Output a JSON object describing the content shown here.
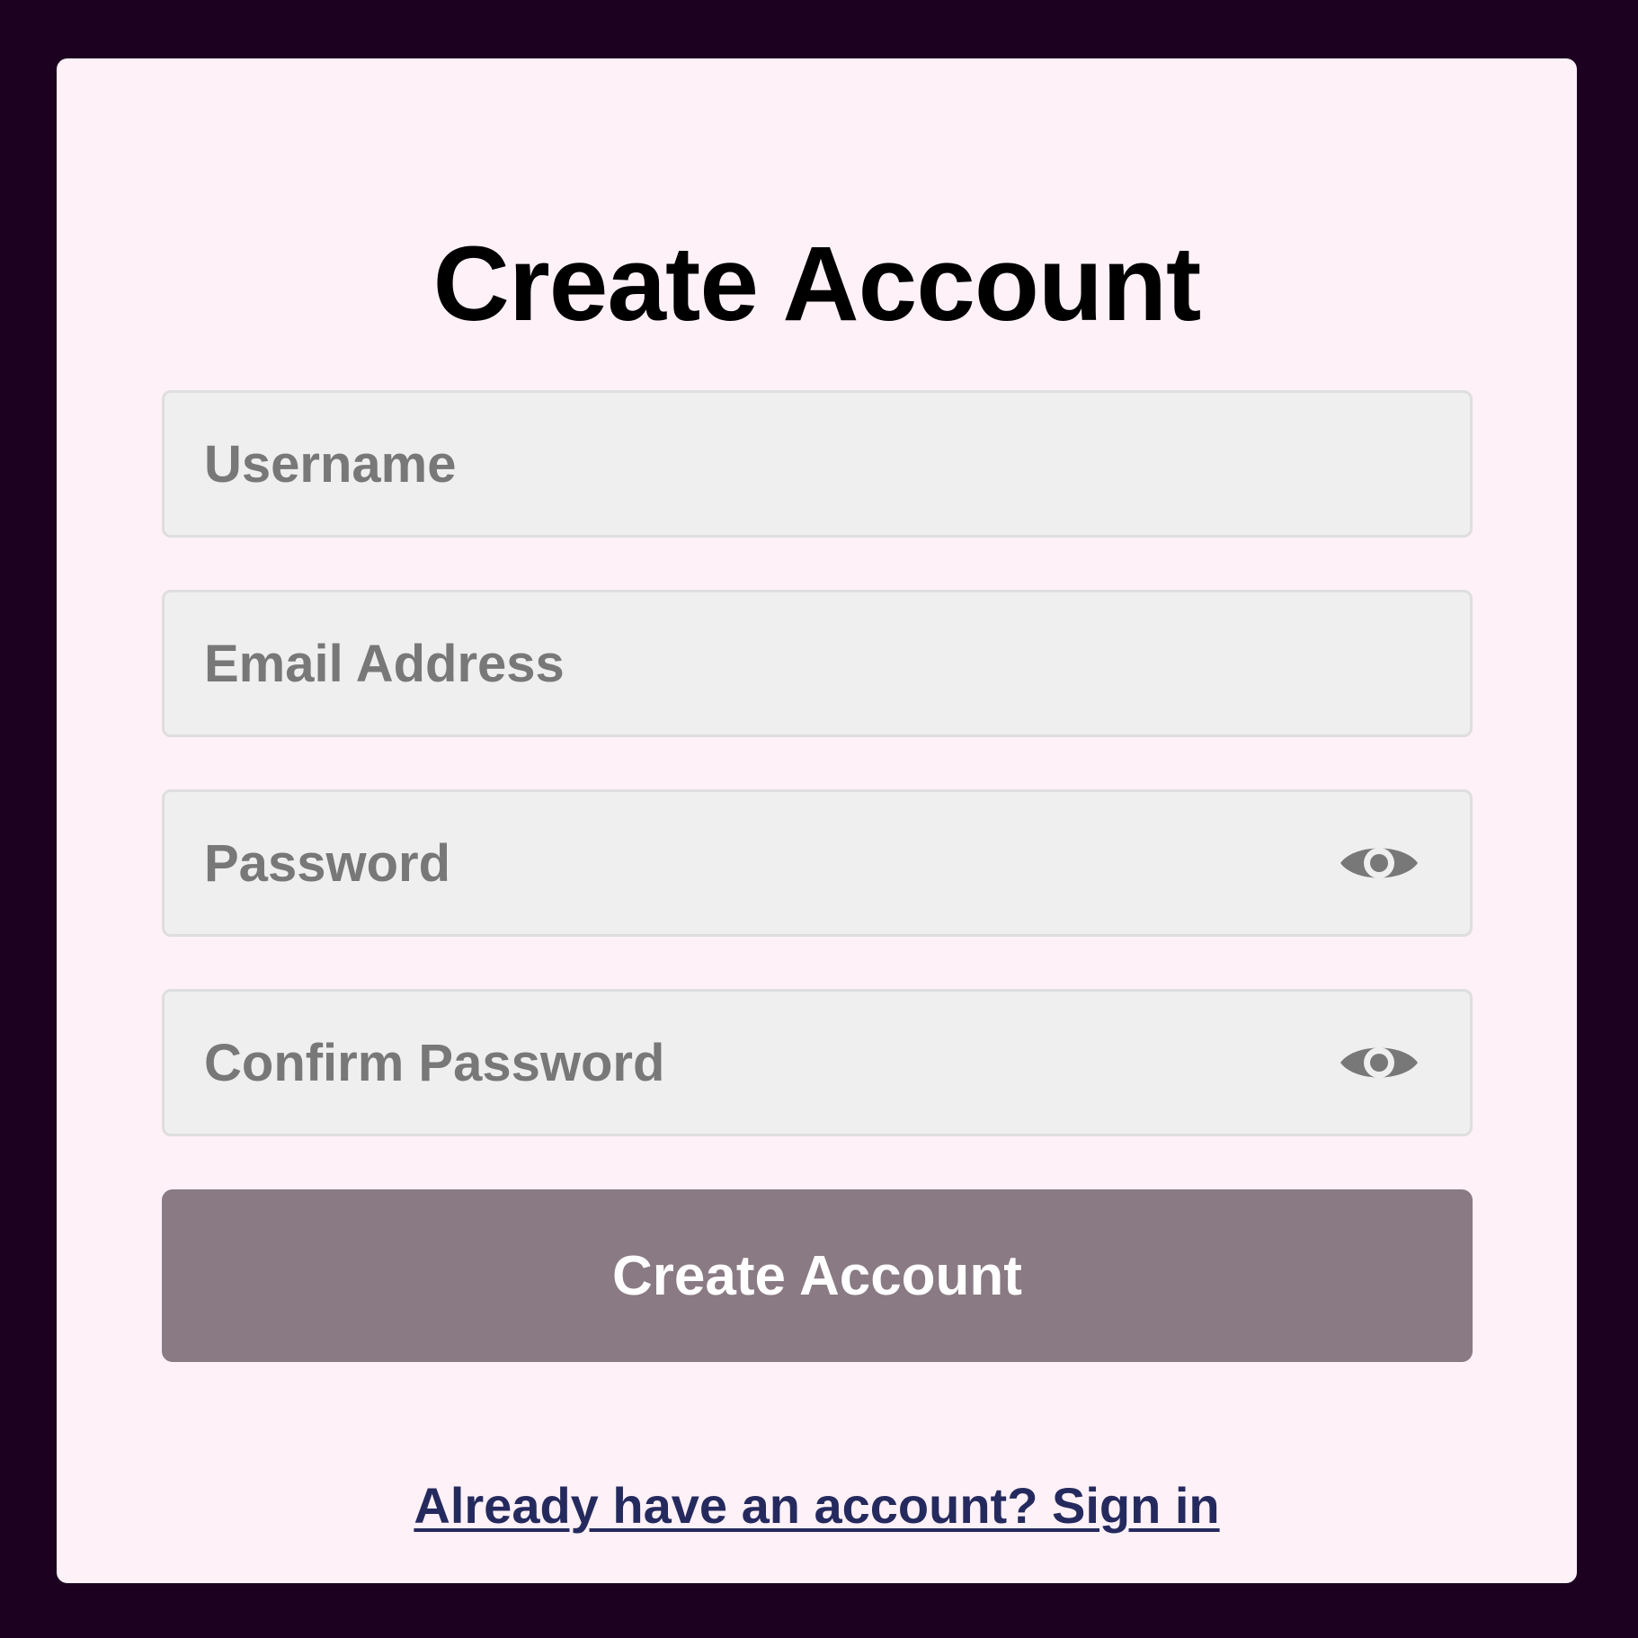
{
  "form": {
    "title": "Create Account",
    "fields": [
      {
        "name": "username",
        "placeholder": "Username",
        "value": ""
      },
      {
        "name": "email",
        "placeholder": "Email Address",
        "value": ""
      },
      {
        "name": "password",
        "placeholder": "Password",
        "value": "",
        "icon": "eye-icon"
      },
      {
        "name": "confirm_password",
        "placeholder": "Confirm Password",
        "value": "",
        "icon": "eye-icon"
      }
    ],
    "submit_label": "Create Account",
    "signin_link": "Already have an account? Sign in"
  },
  "colors": {
    "page_background": "#1c0220",
    "card_background": "#fef1f7",
    "field_background": "#efefef",
    "field_border": "#dedede",
    "placeholder_text": "#787878",
    "button_background": "#8a7a83",
    "button_text": "#ffffff",
    "link_text": "#252a5e"
  }
}
